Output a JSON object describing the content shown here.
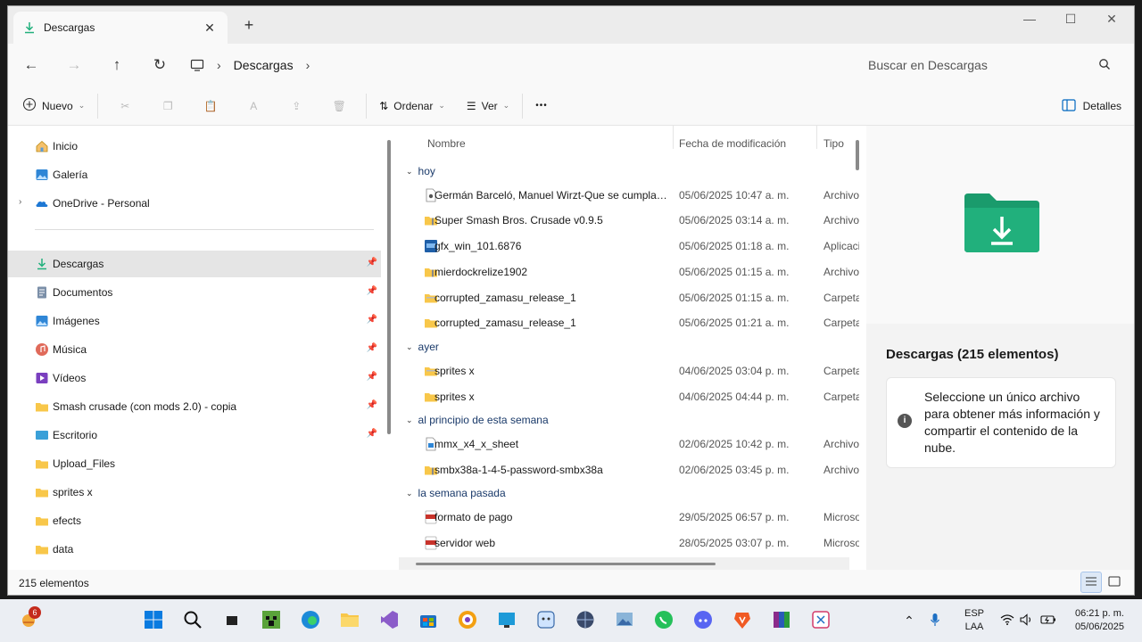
{
  "window": {
    "tab_title": "Descargas",
    "tab_close": "✕",
    "new_tab": "+",
    "minimize": "—",
    "maximize": "☐",
    "close": "✕"
  },
  "nav": {
    "breadcrumb": "Descargas",
    "search_placeholder": "Buscar en Descargas"
  },
  "toolbar": {
    "new_label": "Nuevo",
    "sort_label": "Ordenar",
    "view_label": "Ver",
    "more_label": "•••",
    "details_label": "Detalles"
  },
  "sidebar": {
    "items": [
      {
        "label": "Inicio",
        "icon": "home-icon"
      },
      {
        "label": "Galería",
        "icon": "gallery-icon"
      },
      {
        "label": "OneDrive - Personal",
        "icon": "onedrive-icon"
      },
      {
        "label": "Descargas",
        "icon": "downloads-icon",
        "selected": true,
        "pinned": true
      },
      {
        "label": "Documentos",
        "icon": "documents-icon",
        "pinned": true
      },
      {
        "label": "Imágenes",
        "icon": "pictures-icon",
        "pinned": true
      },
      {
        "label": "Música",
        "icon": "music-icon",
        "pinned": true
      },
      {
        "label": "Vídeos",
        "icon": "videos-icon",
        "pinned": true
      },
      {
        "label": "Smash crusade (con mods 2.0) - copia",
        "icon": "folder-icon",
        "pinned": true
      },
      {
        "label": "Escritorio",
        "icon": "desktop-icon",
        "pinned": true
      },
      {
        "label": "Upload_Files",
        "icon": "folder-icon"
      },
      {
        "label": "sprites x",
        "icon": "folder-icon"
      },
      {
        "label": "efects",
        "icon": "folder-icon"
      },
      {
        "label": "data",
        "icon": "folder-icon"
      }
    ]
  },
  "columns": {
    "name": "Nombre",
    "date": "Fecha de modificación",
    "type": "Tipo"
  },
  "groups": [
    {
      "label": "hoy",
      "rows": [
        {
          "name": "Germán Barceló, Manuel Wirzt-Que se cumplan ...",
          "date": "05/06/2025 10:47 a. m.",
          "type": "Archivo",
          "icon": "media-file-icon"
        },
        {
          "name": "Super Smash Bros. Crusade v0.9.5",
          "date": "05/06/2025 03:14 a. m.",
          "type": "Archivo",
          "icon": "zip-folder-icon"
        },
        {
          "name": "gfx_win_101.6876",
          "date": "05/06/2025 01:18 a. m.",
          "type": "Aplicación",
          "icon": "app-icon"
        },
        {
          "name": "mierdockrelize1902",
          "date": "05/06/2025 01:15 a. m.",
          "type": "Archivo",
          "icon": "zip-folder-icon"
        },
        {
          "name": "corrupted_zamasu_release_1",
          "date": "05/06/2025 01:15 a. m.",
          "type": "Carpeta",
          "icon": "folder-icon"
        },
        {
          "name": "corrupted_zamasu_release_1",
          "date": "05/06/2025 01:21 a. m.",
          "type": "Carpeta",
          "icon": "folder-icon"
        }
      ]
    },
    {
      "label": "ayer",
      "rows": [
        {
          "name": "sprites x",
          "date": "04/06/2025 03:04 p. m.",
          "type": "Carpeta",
          "icon": "folder-icon"
        },
        {
          "name": "sprites x",
          "date": "04/06/2025 04:44 p. m.",
          "type": "Carpeta",
          "icon": "folder-icon"
        }
      ]
    },
    {
      "label": "al principio de esta semana",
      "rows": [
        {
          "name": "mmx_x4_x_sheet",
          "date": "02/06/2025 10:42 p. m.",
          "type": "Archivo",
          "icon": "image-file-icon"
        },
        {
          "name": "smbx38a-1-4-5-password-smbx38a",
          "date": "02/06/2025 03:45 p. m.",
          "type": "Archivo",
          "icon": "zip-folder-icon"
        }
      ]
    },
    {
      "label": "la semana pasada",
      "rows": [
        {
          "name": "formato de pago",
          "date": "29/05/2025 06:57 p. m.",
          "type": "Microsoft",
          "icon": "pdf-icon"
        },
        {
          "name": "servidor web",
          "date": "28/05/2025 03:07 p. m.",
          "type": "Microsoft",
          "icon": "pdf-icon"
        }
      ]
    }
  ],
  "preview": {
    "title": "Descargas (215 elementos)",
    "message": "Seleccione un único archivo para obtener más información y compartir el contenido de la nube.",
    "info": "i"
  },
  "status": {
    "count": "215 elementos"
  },
  "taskbar": {
    "weather_badge": "6",
    "lang_top": "ESP",
    "lang_bottom": "LAA",
    "time": "06:21 p. m.",
    "date": "05/06/2025"
  },
  "colors": {
    "accent": "#0067c0",
    "folder": "#f8c74a",
    "downloads_green": "#21b07c"
  }
}
